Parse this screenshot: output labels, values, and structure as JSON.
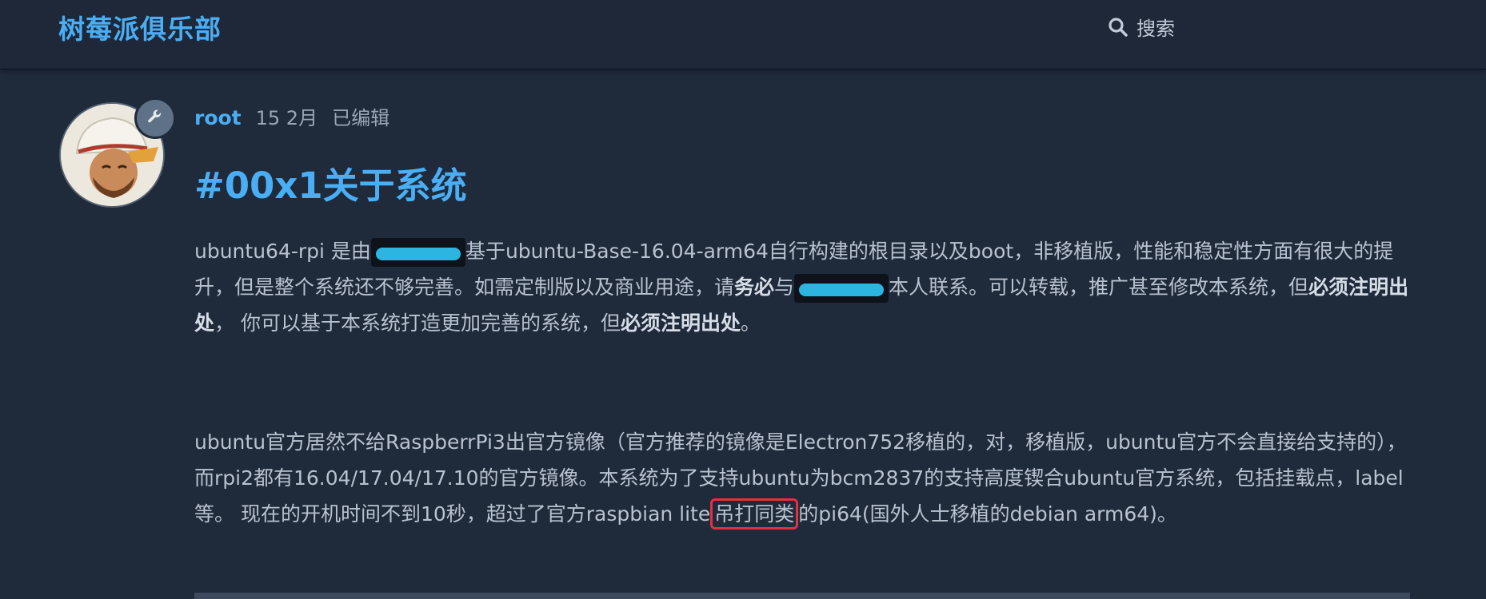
{
  "header": {
    "site_title": "树莓派俱乐部",
    "search_label": "搜索"
  },
  "post": {
    "author": "root",
    "date": "15 2月",
    "edited": "已编辑",
    "title": "#00x1关于系统",
    "paragraph1": {
      "t1": "ubuntu64-rpi 是由",
      "t2": "基于ubuntu-Base-16.04-arm64自行构建的根目录以及boot，非移植版，性能和稳定性方面有很大的提升，但是整个系统还不够完善。如需定制版以及商业用途，请",
      "b1": "务必",
      "t3": "与",
      "t4": "本人联系。可以转载，推广甚至修改本系统，但",
      "b2": "必须注明出处",
      "t5": "， 你可以基于本系统打造更加完善的系统，但",
      "b3": "必须注明出处",
      "t6": "。"
    },
    "paragraph2": {
      "t1": "ubuntu官方居然不给RaspberrPi3出官方镜像（官方推荐的镜像是Electron752移植的，对，移植版，ubuntu官方不会直接给支持的），而rpi2都有16.04/17.04/17.10的官方镜像。本系统为了支持ubuntu为bcm2837的支持高度锲合ubuntu官方系统，包括挂载点，label等。 现在的开机时间不到10秒，超过了官方raspbian lite",
      "highlight": "吊打同类",
      "t2": "的pi64(国外人士移植的debian arm64)。"
    }
  },
  "colors": {
    "background": "#1f2a3b",
    "accent": "#4aaef5",
    "text": "#b9c2cf",
    "highlight_box": "#e53040",
    "redaction": "#2cb5e0"
  },
  "icons": {
    "search": "search-icon",
    "moderator": "wrench-icon"
  }
}
